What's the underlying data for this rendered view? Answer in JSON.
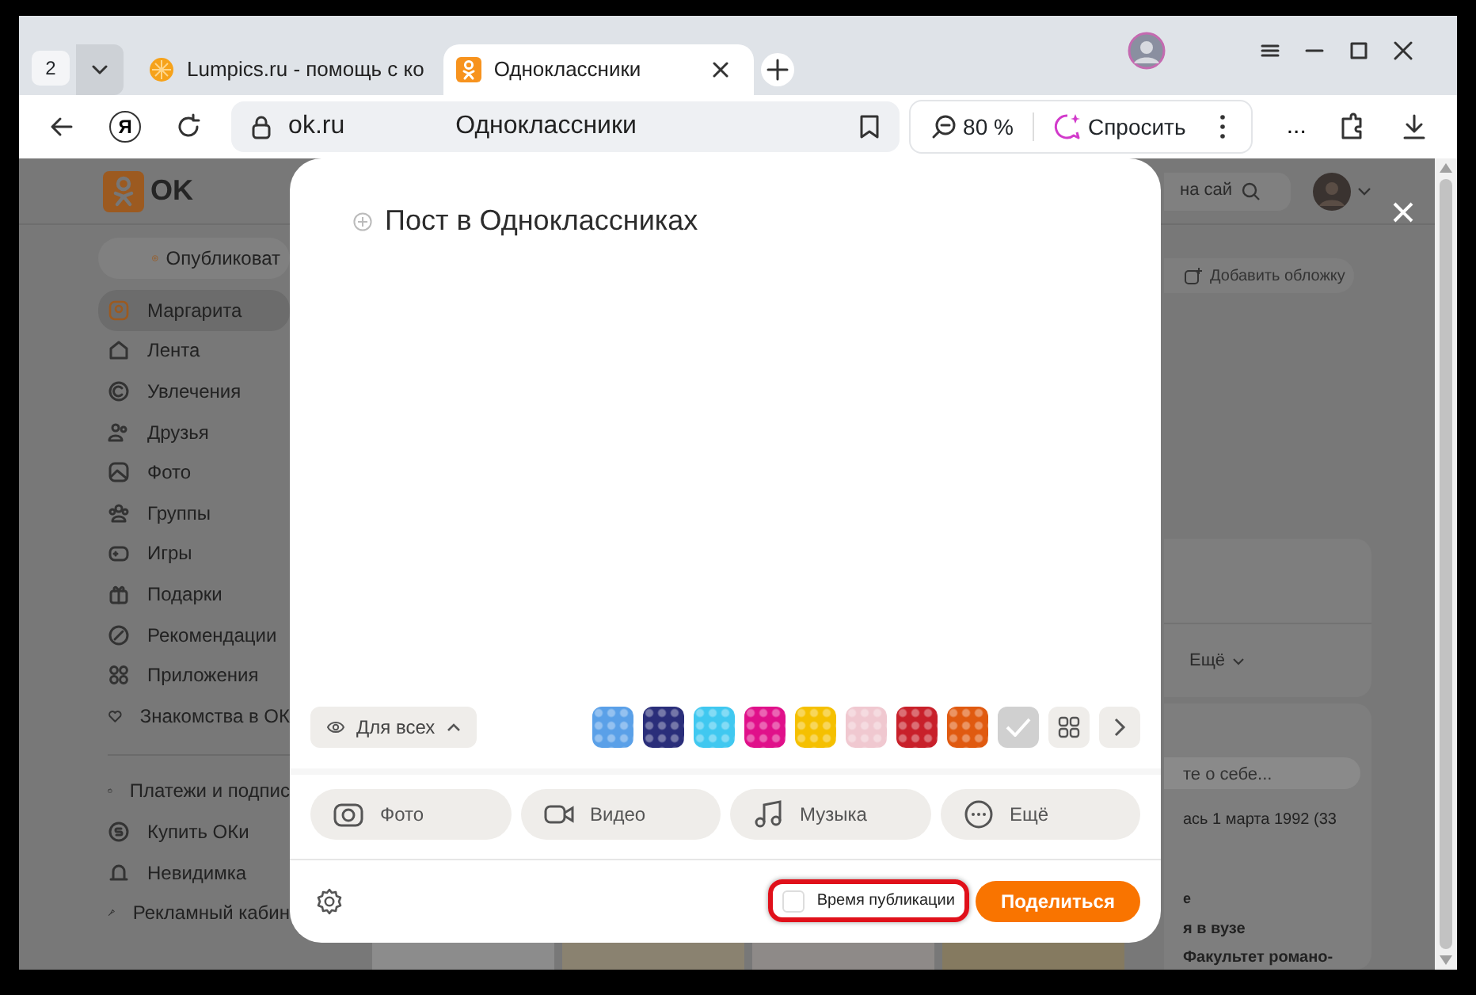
{
  "browser": {
    "tab_count": "2",
    "tabs": [
      {
        "title": "Lumpics.ru - помощь с ко",
        "selected": false
      },
      {
        "title": "Одноклассники",
        "selected": true
      }
    ],
    "toolbar": {
      "logo_letter": "Я",
      "url": "ok.ru",
      "page_title": "Одноклассники",
      "zoom": "80 %",
      "ask": "Спросить",
      "more": "..."
    }
  },
  "page": {
    "logo": "OK",
    "publish": "Опубликоват",
    "sidebar": [
      {
        "label": "Маргарита",
        "selected": true
      },
      {
        "label": "Лента",
        "selected": false
      },
      {
        "label": "Увлечения",
        "selected": false
      },
      {
        "label": "Друзья",
        "selected": false
      },
      {
        "label": "Фото",
        "selected": false
      },
      {
        "label": "Группы",
        "selected": false
      },
      {
        "label": "Игры",
        "selected": false
      },
      {
        "label": "Подарки",
        "selected": false
      },
      {
        "label": "Рекомендации",
        "selected": false
      },
      {
        "label": "Приложения",
        "selected": false
      },
      {
        "label": "Знакомства в ОК",
        "selected": false
      }
    ],
    "sidebar_extra": [
      {
        "label": "Платежи и подпис",
        "selected": false
      },
      {
        "label": "Купить ОКи",
        "selected": false
      },
      {
        "label": "Невидимка",
        "selected": false
      },
      {
        "label": "Рекламный кабин",
        "selected": false
      }
    ],
    "search_fragment": "на сай",
    "cover": "Добавить обложку",
    "more": "Ещё",
    "about_placeholder": "те о себе...",
    "birthday": "ась 1 марта 1992 (33",
    "fragment": "е",
    "education": "я в вузе",
    "faculty": "Факультет романо-"
  },
  "modal": {
    "text": "Пост в Одноклассниках",
    "audience": "Для всех",
    "backgrounds": [
      {
        "kind": "image",
        "color": "#5aa0e8"
      },
      {
        "kind": "image",
        "color": "#2a2e7a"
      },
      {
        "kind": "image",
        "color": "#40c8f0"
      },
      {
        "kind": "image",
        "color": "#e0108a"
      },
      {
        "kind": "image",
        "color": "#f5c000"
      },
      {
        "kind": "image",
        "color": "#f0c8d0"
      },
      {
        "kind": "image",
        "color": "#c8202a"
      },
      {
        "kind": "image",
        "color": "#e05a10"
      },
      {
        "kind": "none",
        "color": "#d0d0d0"
      }
    ],
    "attachments": [
      "Фото",
      "Видео",
      "Музыка",
      "Ещё"
    ],
    "schedule": {
      "label": "Время публикации",
      "checked": false,
      "highlighted": true
    },
    "share": "Поделиться"
  }
}
